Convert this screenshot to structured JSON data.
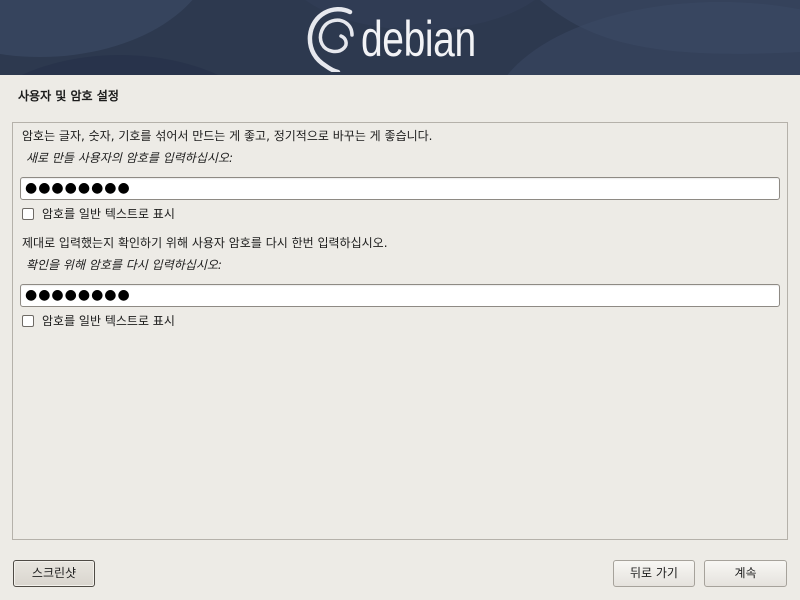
{
  "banner": {
    "logo_text": "debian",
    "logo_icon": "debian-swirl-icon",
    "background_color": "#2d394f"
  },
  "page": {
    "title": "사용자 및 암호 설정",
    "background_color": "#edebe6"
  },
  "form": {
    "password": {
      "description": "암호는 글자, 숫자, 기호를 섞어서 만드는 게 좋고, 정기적으로 바꾸는 게 좋습니다.",
      "prompt": "새로 만들 사용자의 암호를 입력하십시오:",
      "value": "●●●●●●●●",
      "show_plain_label": "암호를 일반 텍스트로 표시",
      "show_plain_checked": false
    },
    "confirm": {
      "description": "제대로 입력했는지 확인하기 위해 사용자 암호를 다시 한번 입력하십시오.",
      "prompt": "확인을 위해 암호를 다시 입력하십시오:",
      "value": "●●●●●●●●",
      "show_plain_label": "암호를 일반 텍스트로 표시",
      "show_plain_checked": false
    }
  },
  "buttons": {
    "screenshot": "스크린샷",
    "back": "뒤로 가기",
    "continue": "계속"
  }
}
